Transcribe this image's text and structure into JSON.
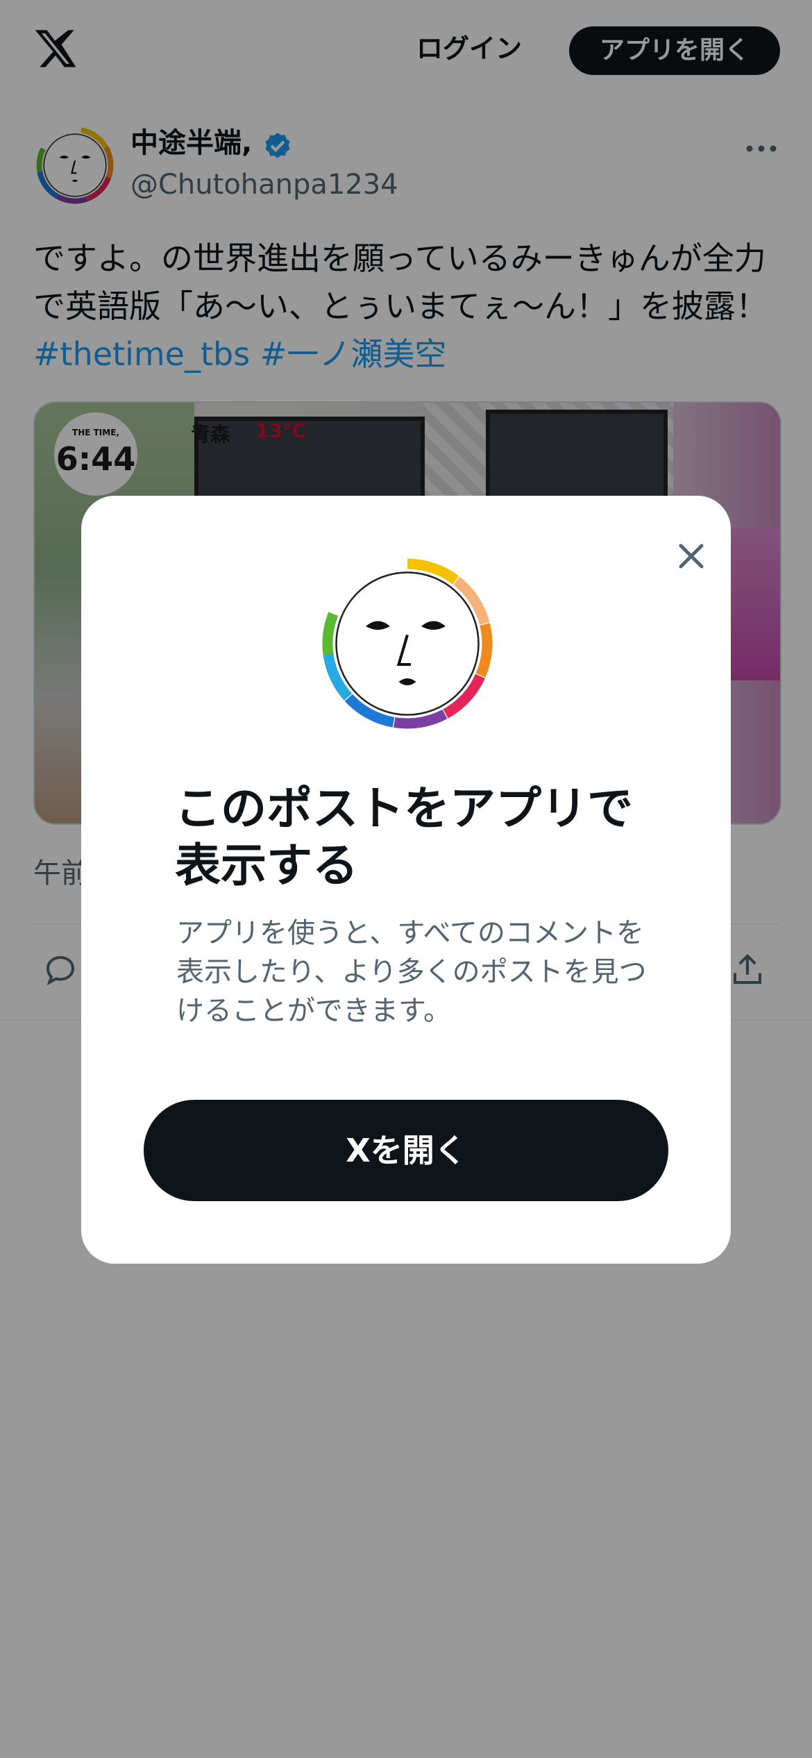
{
  "header": {
    "logo_icon": "x-logo-icon",
    "login_label": "ログイン",
    "open_app_label": "アプリを開く"
  },
  "post": {
    "display_name": "中途半端,",
    "handle": "@Chutohanpa1234",
    "verified_icon": "verified-badge-icon",
    "more_icon": "more-options-icon",
    "text": "ですよ。の世界進出を願っているみーきゅんが全力で英語版「あ〜い、とぅいまてぇ〜ん！」を披露！",
    "hashtags": [
      "#thetime_tbs",
      "#一ノ瀬美空"
    ],
    "media": {
      "clock_label": "THE TIME,",
      "clock_time": "6:44",
      "weather_city": "青森",
      "weather_temp": "13℃"
    },
    "timestamp_partial": "午前",
    "reply_icon": "reply-icon",
    "share_icon": "share-icon"
  },
  "modal": {
    "close_icon": "close-icon",
    "avatar_icon": "face-logo-icon",
    "title": "このポストをアプリで表示する",
    "description": "アプリを使うと、すべてのコメントを表示したり、より多くのポストを見つけることができます。",
    "open_button_label": "Xを開く"
  },
  "colors": {
    "overlay": "rgba(0,0,0,0.4)",
    "button_dark": "#0f1419",
    "link_blue": "#1d9bf0",
    "secondary_text": "#536471"
  }
}
